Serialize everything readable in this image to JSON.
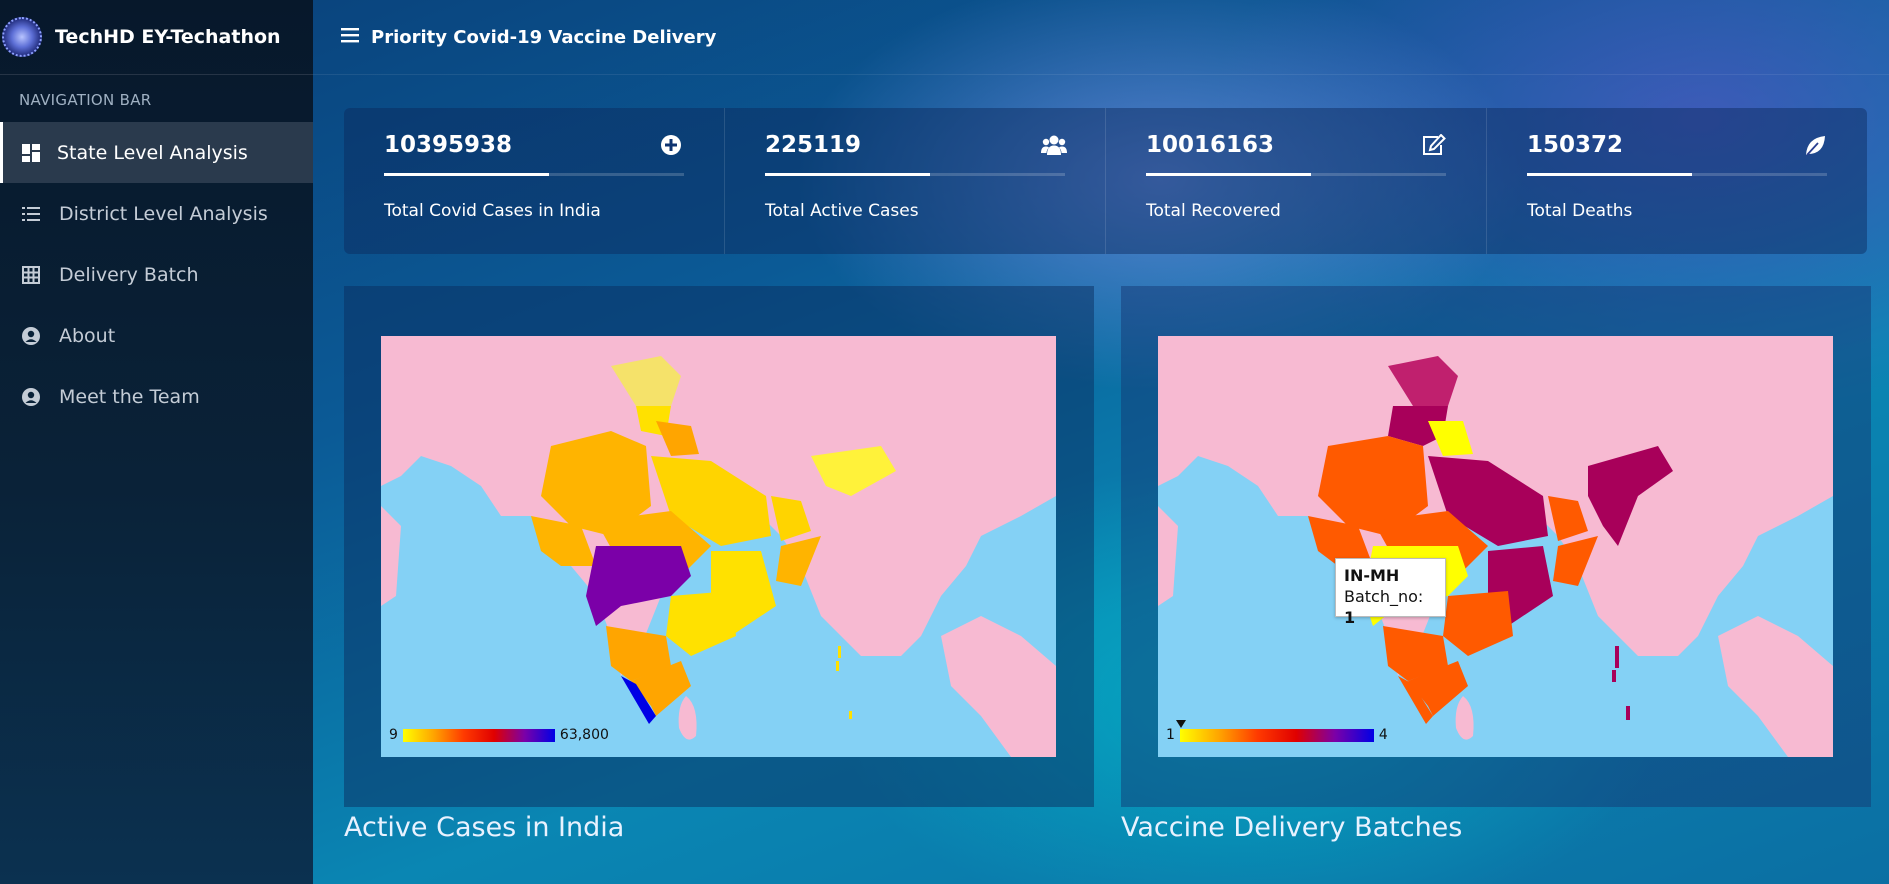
{
  "brand": {
    "name": "TechHD EY-Techathon"
  },
  "nav": {
    "heading": "NAVIGATION BAR",
    "items": [
      {
        "label": "State Level Analysis",
        "icon": "dashboard-icon",
        "active": true
      },
      {
        "label": "District Level Analysis",
        "icon": "list-icon",
        "active": false
      },
      {
        "label": "Delivery Batch",
        "icon": "grid-icon",
        "active": false
      },
      {
        "label": "About",
        "icon": "user-circle-icon",
        "active": false
      },
      {
        "label": "Meet the Team",
        "icon": "user-circle-icon",
        "active": false
      }
    ]
  },
  "header": {
    "title": "Priority Covid-19 Vaccine Delivery"
  },
  "stats": [
    {
      "value": "10395938",
      "label": "Total Covid Cases in India",
      "icon": "plus-circle-icon",
      "progress": 0.55
    },
    {
      "value": "225119",
      "label": "Total Active Cases",
      "icon": "users-icon",
      "progress": 0.55
    },
    {
      "value": "10016163",
      "label": "Total Recovered",
      "icon": "edit-icon",
      "progress": 0.55
    },
    {
      "value": "150372",
      "label": "Total Deaths",
      "icon": "leaf-icon",
      "progress": 0.55
    }
  ],
  "maps": {
    "active_cases": {
      "caption": "Active Cases in India",
      "legend_min": "9",
      "legend_max": "63,800",
      "colors": {
        "land": "#f7bad2",
        "sea": "#84d1f5",
        "low": "#ffff00",
        "mid": "#ffa500",
        "high": "#7b00a8",
        "max": "#0000e6"
      }
    },
    "delivery_batches": {
      "caption": "Vaccine Delivery Batches",
      "legend_min": "1",
      "legend_max": "4",
      "tooltip": {
        "title": "IN-MH",
        "key": "Batch_no:",
        "value": "1"
      },
      "colors": {
        "batch1": "#ffff00",
        "batch2": "#ff5a00",
        "batch3": "#a8005a"
      }
    }
  }
}
